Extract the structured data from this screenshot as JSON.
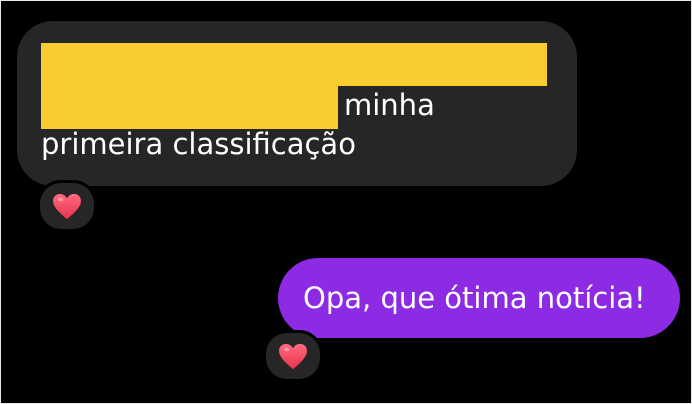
{
  "conversation": {
    "incoming": {
      "line1": "minha",
      "line2": "primeira classificação",
      "reaction_icon": "heart-icon"
    },
    "outgoing": {
      "text": "Opa, que ótima notícia!",
      "reaction_icon": "heart-icon"
    }
  },
  "colors": {
    "background": "#000000",
    "incoming_bubble": "#262626",
    "outgoing_bubble": "#8c2ae4",
    "redaction": "#f9cd2f",
    "heart": "#f2475e"
  }
}
